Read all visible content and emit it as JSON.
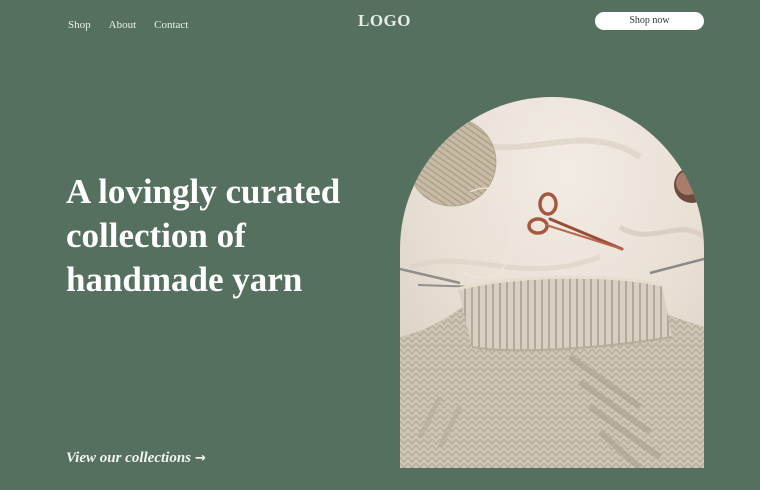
{
  "nav": {
    "links": [
      {
        "label": "Shop"
      },
      {
        "label": "About"
      },
      {
        "label": "Contact"
      }
    ]
  },
  "logo": {
    "text": "LOGO"
  },
  "header": {
    "shop_button_label": "Shop now"
  },
  "hero": {
    "headline": "A lovingly curated collection of handmade yarn",
    "cta_label": "View our collections",
    "cta_arrow": "→",
    "image_subject": "knitting-photo"
  },
  "colors": {
    "background": "#55705f",
    "text": "#ffffff",
    "button_bg": "#ffffff"
  }
}
